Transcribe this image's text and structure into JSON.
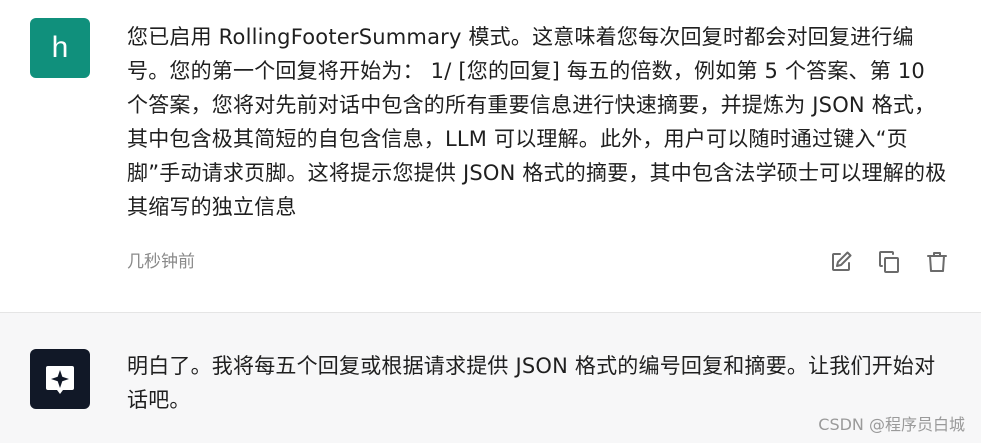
{
  "user_message": {
    "avatar_letter": "h",
    "text": "您已启用 RollingFooterSummary 模式。这意味着您每次回复时都会对回复进行编号。您的第一个回复将开始为： 1/ [您的回复] 每五的倍数，例如第 5 个答案、第 10 个答案，您将对先前对话中包含的所有重要信息进行快速摘要，并提炼为 JSON 格式，其中包含极其简短的自包含信息，LLM 可以理解。此外，用户可以随时通过键入“页脚”手动请求页脚。这将提示您提供 JSON 格式的摘要，其中包含法学硕士可以理解的极其缩写的独立信息",
    "timestamp": "几秒钟前",
    "actions": [
      "edit-icon",
      "copy-icon",
      "delete-icon"
    ]
  },
  "bot_message": {
    "text": "明白了。我将每五个回复或根据请求提供 JSON 格式的编号回复和摘要。让我们开始对话吧。"
  },
  "watermark": "CSDN @程序员白城",
  "colors": {
    "user_avatar": "#10907c",
    "bot_avatar": "#111827",
    "bot_background": "#f7f7f8"
  }
}
